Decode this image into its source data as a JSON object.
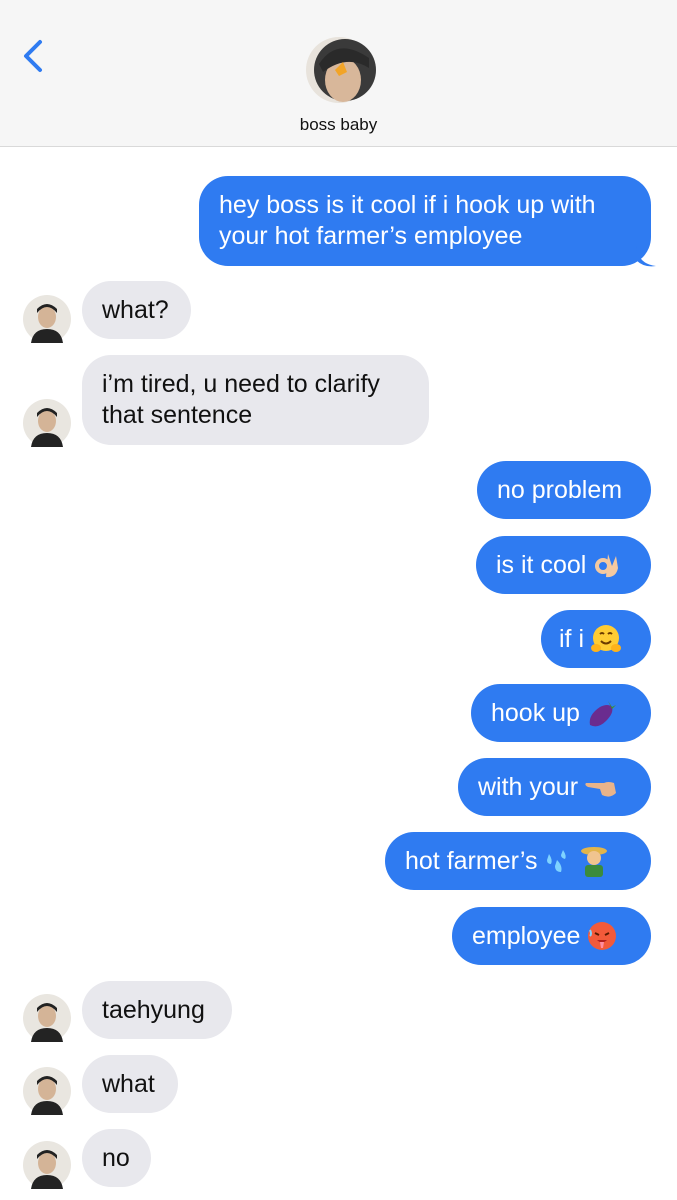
{
  "header": {
    "back_icon": "chevron-left-icon",
    "contact_name": "boss baby",
    "accent": "#2f7bf1"
  },
  "colors": {
    "sent_bubble": "#2f7bf1",
    "received_bubble": "#e8e8ed"
  },
  "messages": [
    {
      "from": "me",
      "text": "hey boss is it cool if i hook up with your hot farmer’s employee"
    },
    {
      "from": "them",
      "text": "what?"
    },
    {
      "from": "them",
      "text": "i’m tired, u need to clarify that sentence"
    },
    {
      "from": "me",
      "text": "no problem"
    },
    {
      "from": "me",
      "text": "is it cool",
      "emoji": "ok-hand-emoji"
    },
    {
      "from": "me",
      "text": "if i",
      "emoji": "hugging-face-emoji"
    },
    {
      "from": "me",
      "text": "hook up",
      "emoji": "eggplant-emoji"
    },
    {
      "from": "me",
      "text": "with your",
      "emoji": "pointing-left-hand-emoji"
    },
    {
      "from": "me",
      "text": "hot farmer’s",
      "emoji": "sweat-droplets-farmer-emoji"
    },
    {
      "from": "me",
      "text": "employee",
      "emoji": "hot-face-emoji"
    },
    {
      "from": "them",
      "text": "taehyung"
    },
    {
      "from": "them",
      "text": "what"
    },
    {
      "from": "them",
      "text": "no"
    }
  ]
}
